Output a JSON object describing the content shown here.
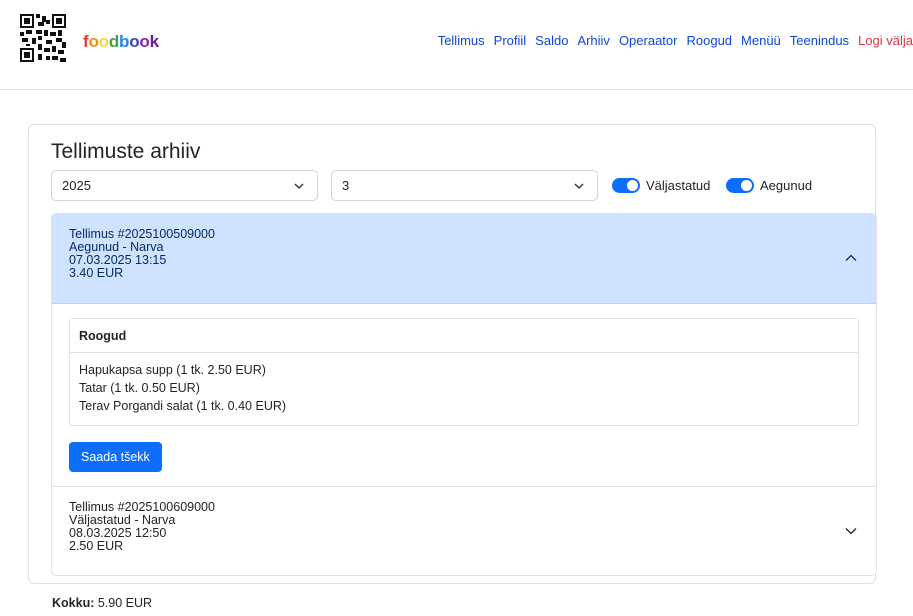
{
  "brand": {
    "name_letters": [
      {
        "ch": "f",
        "color": "#e53935"
      },
      {
        "ch": "o",
        "color": "#fb8c00"
      },
      {
        "ch": "o",
        "color": "#fdd835"
      },
      {
        "ch": "d",
        "color": "#43a047"
      },
      {
        "ch": "b",
        "color": "#1e88e5"
      },
      {
        "ch": "o",
        "color": "#3949ab"
      },
      {
        "ch": "o",
        "color": "#8e24aa"
      },
      {
        "ch": "k",
        "color": "#6a1b9a"
      }
    ],
    "logo_icon": "qr-code-icon"
  },
  "nav": {
    "items": [
      "Tellimus",
      "Profiil",
      "Saldo",
      "Arhiiv",
      "Operaator",
      "Roogud",
      "Menüü",
      "Teenindus"
    ],
    "logout": "Logi välja"
  },
  "archive": {
    "title": "Tellimuste arhiiv",
    "year_value": "2025",
    "month_value": "3",
    "filters": [
      {
        "label": "Väljastatud",
        "checked": true
      },
      {
        "label": "Aegunud",
        "checked": true
      }
    ]
  },
  "orders": [
    {
      "title": "Tellimus #2025100509000",
      "status": "Aegunud - Narva",
      "datetime": "07.03.2025 13:15",
      "amount": "3.40 EUR",
      "expanded": true,
      "dishes_header": "Roogud",
      "dishes": [
        "Hapukapsa supp (1 tk. 2.50 EUR)",
        "Tatar (1 tk. 0.50 EUR)",
        "Terav Porgandi salat (1 tk. 0.40 EUR)"
      ],
      "button": "Saada tšekk"
    },
    {
      "title": "Tellimus #2025100609000",
      "status": "Väljastatud - Narva",
      "datetime": "08.03.2025 12:50",
      "amount": "2.50 EUR",
      "expanded": false
    }
  ],
  "total": {
    "label": "Kokku:",
    "value": "5.90 EUR"
  },
  "colors": {
    "accent": "#0d6efd",
    "link": "#0d47d9",
    "logout": "#dc3545",
    "open_header_bg": "#cfe2ff"
  }
}
